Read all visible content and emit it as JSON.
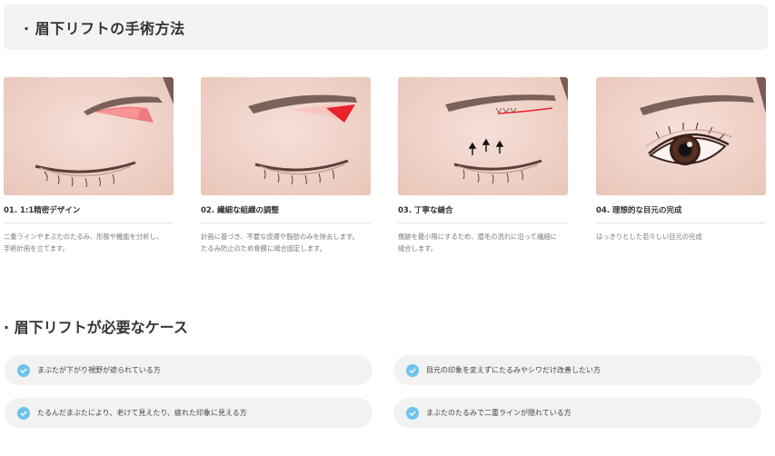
{
  "header": {
    "title": "· 眉下リフトの手術方法"
  },
  "steps": [
    {
      "caption": "01. 1:1精密デザイン",
      "desc": [
        "二重ラインやまぶたのたるみ、形態や機能を分析し、",
        "手術計画を立てます。"
      ]
    },
    {
      "caption": "02. 繊細な組織の調整",
      "desc": [
        "計画に基づき、不要な皮膚や脂肪のみを除去します。",
        "たるみ防止のため骨膜に縫合固定します。"
      ]
    },
    {
      "caption": "03. 丁寧な縫合",
      "desc": [
        "傷跡を最小限にするため、眉毛の流れに沿って繊細に",
        "縫合します。"
      ]
    },
    {
      "caption": "04. 理想的な目元の完成",
      "desc": [
        "はっきりとした若々しい目元の完成"
      ]
    }
  ],
  "cases": {
    "title": "· 眉下リフトが必要なケース",
    "items": [
      "まぶたが下がり視野が遮られている方",
      "目元の印象を変えずにたるみやシワだけ改善したい方",
      "たるんだまぶたにより、老けて見えたり、疲れた印象に見える方",
      "まぶたのたるみで二重ラインが隠れている方"
    ]
  },
  "colors": {
    "accent": "#6ec3ee",
    "incision": "#e8232a",
    "skin": "#f2d3c8"
  },
  "icons": {
    "check": "check-circle-icon",
    "arrow": "arrow-up-icon"
  }
}
